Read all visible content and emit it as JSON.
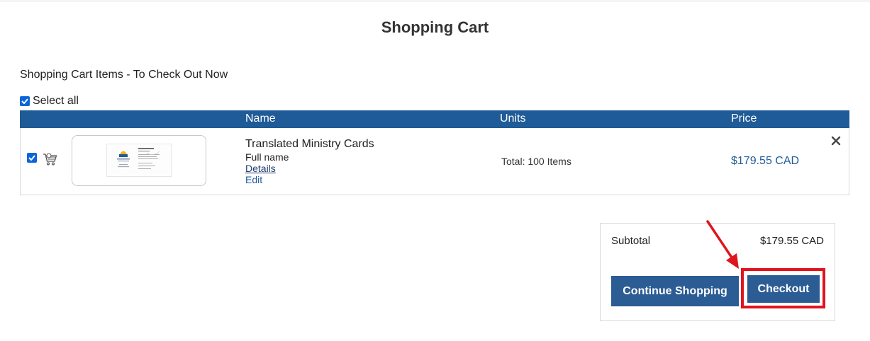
{
  "page": {
    "title": "Shopping Cart",
    "section_heading": "Shopping Cart Items - To Check Out Now",
    "select_all_label": "Select all"
  },
  "table": {
    "headers": [
      "Name",
      "Units",
      "Price"
    ],
    "items": [
      {
        "selected": true,
        "name": "Translated Ministry Cards",
        "variant": "Full name",
        "details_label": "Details",
        "edit_label": "Edit",
        "units": "Total: 100 Items",
        "price": "$179.55 CAD"
      }
    ]
  },
  "summary": {
    "subtotal_label": "Subtotal",
    "subtotal_value": "$179.55 CAD",
    "continue_label": "Continue Shopping",
    "checkout_label": "Checkout"
  },
  "icons": {
    "select_all": "checkbox-checked-icon",
    "row_checkbox": "checkbox-checked-icon",
    "cart": "cart-icon",
    "remove": "close-icon",
    "annotation": "red-arrow-icon"
  },
  "colors": {
    "header_bg": "#1f5b96",
    "button_bg": "#2b5c94",
    "price_text": "#1f5b96",
    "highlight": "#e0141e"
  }
}
